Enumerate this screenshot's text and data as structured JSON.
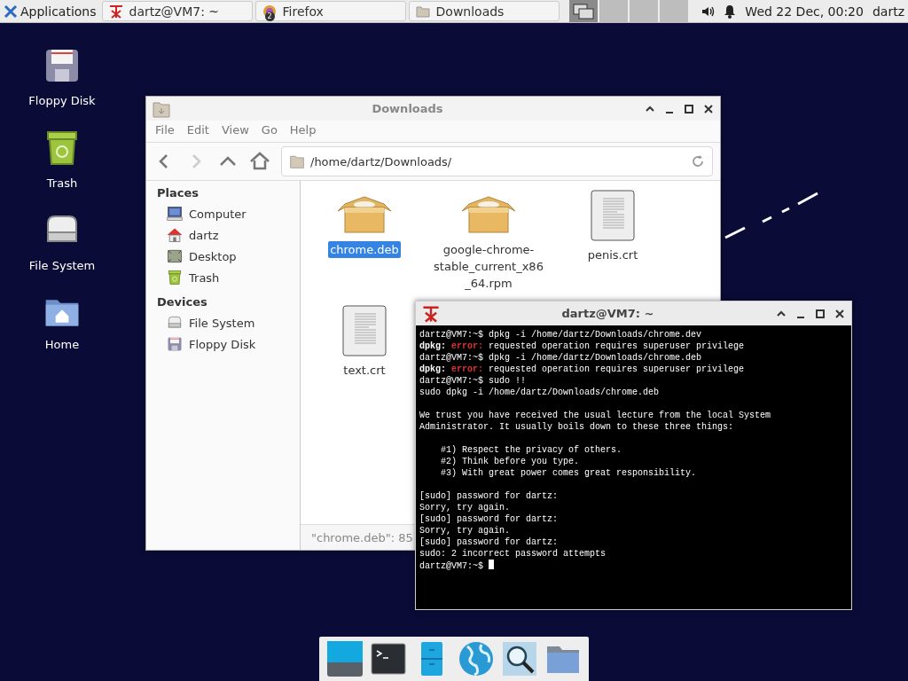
{
  "panel": {
    "apps_menu": "Applications",
    "tasks": [
      {
        "title": "dartz@VM7: ~",
        "kind": "terminal"
      },
      {
        "title": "Firefox",
        "kind": "browser",
        "badge": "2"
      },
      {
        "title": "Downloads",
        "kind": "folder"
      }
    ],
    "workspaces": [
      {
        "selected": true
      },
      {
        "selected": false
      },
      {
        "selected": false
      },
      {
        "selected": false
      }
    ],
    "clock": "Wed 22 Dec, 00:20",
    "user": "dartz"
  },
  "desktop_icons": [
    {
      "label": "Floppy Disk",
      "kind": "floppy"
    },
    {
      "label": "Trash",
      "kind": "trash"
    },
    {
      "label": "File System",
      "kind": "drive"
    },
    {
      "label": "Home",
      "kind": "home"
    }
  ],
  "file_manager": {
    "title": "Downloads",
    "menu": [
      "File",
      "Edit",
      "View",
      "Go",
      "Help"
    ],
    "path": "/home/dartz/Downloads/",
    "sidebar": [
      {
        "heading": "Places",
        "items": [
          {
            "label": "Computer",
            "kind": "computer"
          },
          {
            "label": "dartz",
            "kind": "home"
          },
          {
            "label": "Desktop",
            "kind": "desktop"
          },
          {
            "label": "Trash",
            "kind": "trash"
          }
        ]
      },
      {
        "heading": "Devices",
        "items": [
          {
            "label": "File System",
            "kind": "drive"
          },
          {
            "label": "Floppy Disk",
            "kind": "floppy"
          }
        ]
      }
    ],
    "files": [
      {
        "name": "chrome.deb",
        "kind": "package",
        "selected": true
      },
      {
        "name": "google-chrome-stable_current_x86_64.rpm",
        "kind": "package",
        "selected": false
      },
      {
        "name": "penis.crt",
        "kind": "text",
        "selected": false
      },
      {
        "name": "text.crt",
        "kind": "text",
        "selected": false
      }
    ],
    "status": "\"chrome.deb\": 85"
  },
  "terminal": {
    "title": "dartz@VM7: ~",
    "lines": [
      {
        "kind": "plain",
        "text": "dartz@VM7:~$ dpkg -i /home/dartz/Downloads/chrome.dev"
      },
      {
        "kind": "error",
        "prefix": "dpkg:",
        "tag": "error:",
        "text": "requested operation requires superuser privilege"
      },
      {
        "kind": "plain",
        "text": "dartz@VM7:~$ dpkg -i /home/dartz/Downloads/chrome.deb"
      },
      {
        "kind": "error",
        "prefix": "dpkg:",
        "tag": "error:",
        "text": "requested operation requires superuser privilege"
      },
      {
        "kind": "plain",
        "text": "dartz@VM7:~$ sudo !!"
      },
      {
        "kind": "plain",
        "text": "sudo dpkg -i /home/dartz/Downloads/chrome.deb"
      },
      {
        "kind": "blank"
      },
      {
        "kind": "plain",
        "text": "We trust you have received the usual lecture from the local System"
      },
      {
        "kind": "plain",
        "text": "Administrator. It usually boils down to these three things:"
      },
      {
        "kind": "blank"
      },
      {
        "kind": "plain",
        "text": "    #1) Respect the privacy of others."
      },
      {
        "kind": "plain",
        "text": "    #2) Think before you type."
      },
      {
        "kind": "plain",
        "text": "    #3) With great power comes great responsibility."
      },
      {
        "kind": "blank"
      },
      {
        "kind": "plain",
        "text": "[sudo] password for dartz:"
      },
      {
        "kind": "plain",
        "text": "Sorry, try again."
      },
      {
        "kind": "plain",
        "text": "[sudo] password for dartz:"
      },
      {
        "kind": "plain",
        "text": "Sorry, try again."
      },
      {
        "kind": "plain",
        "text": "[sudo] password for dartz:"
      },
      {
        "kind": "plain",
        "text": "sudo: 2 incorrect password attempts"
      },
      {
        "kind": "prompt",
        "text": "dartz@VM7:~$"
      }
    ]
  },
  "dock": [
    {
      "kind": "desktop"
    },
    {
      "kind": "terminal"
    },
    {
      "kind": "files"
    },
    {
      "kind": "web"
    },
    {
      "kind": "search"
    },
    {
      "kind": "folder"
    }
  ]
}
